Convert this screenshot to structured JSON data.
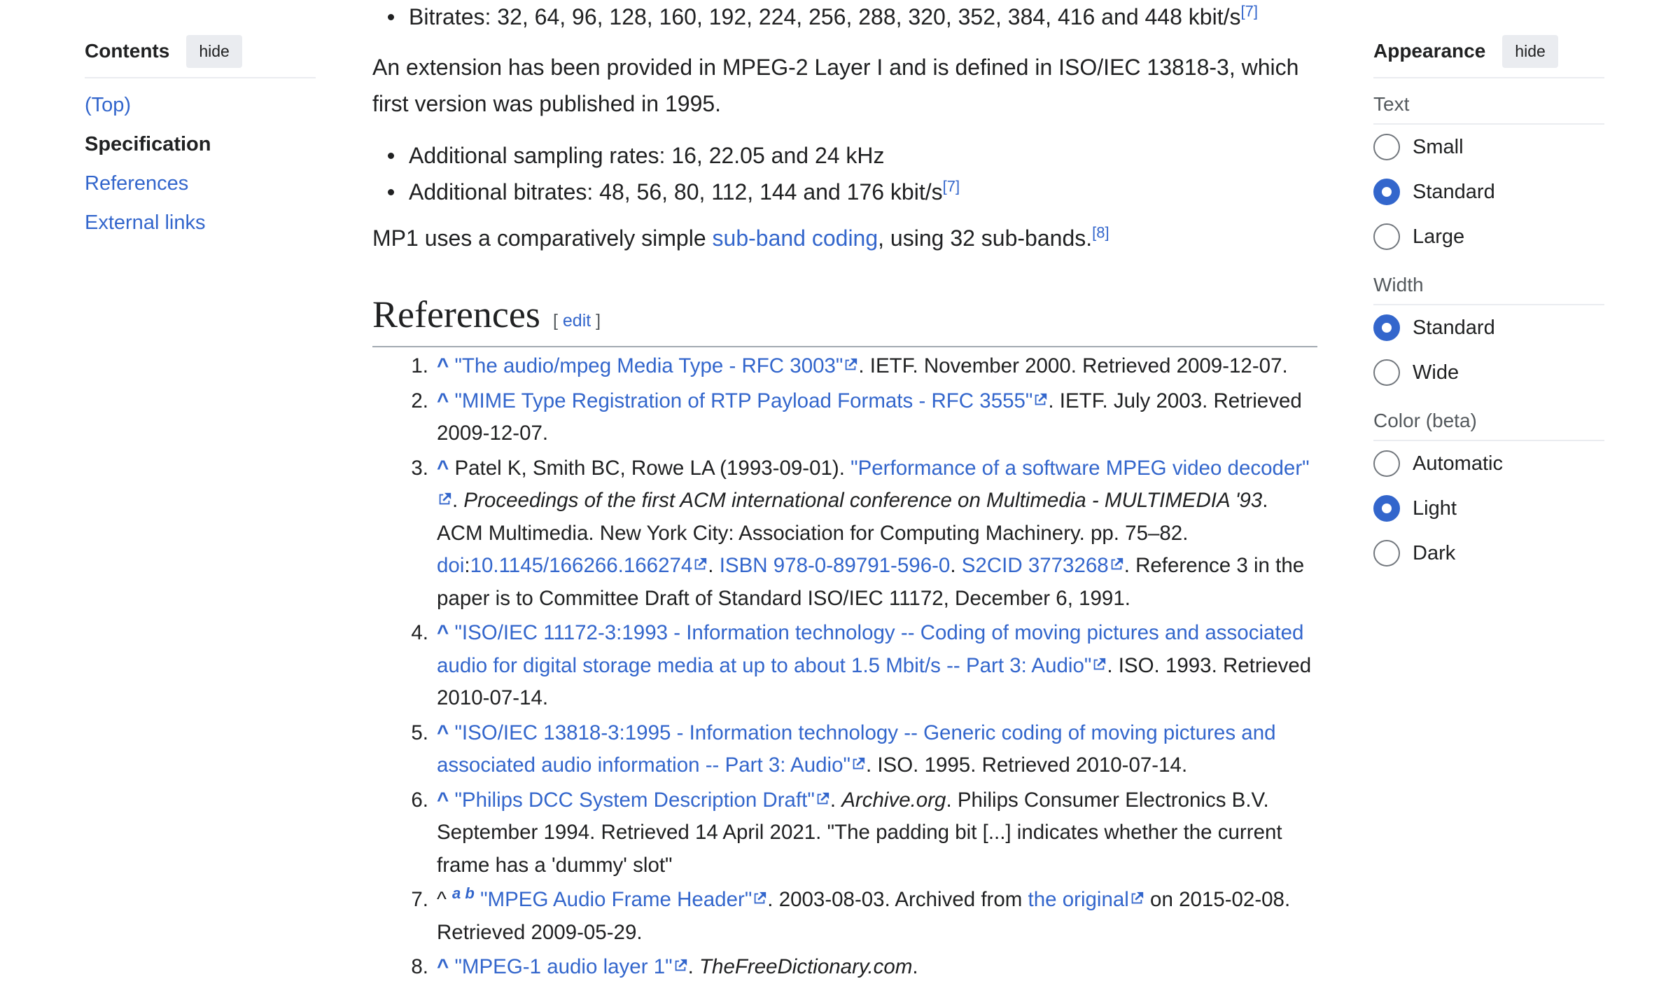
{
  "toc": {
    "title": "Contents",
    "hide_label": "hide",
    "items": [
      "(Top)",
      "Specification",
      "References",
      "External links"
    ]
  },
  "content": {
    "bitrates_prefix": "Bitrates: 32, 64, 96, 128, 160, 192, 224, 256, 288, 320, 352, 384, 416 and 448 kbit/s",
    "cite7": "[7]",
    "ext_para": "An extension has been provided in MPEG-2 Layer I and is defined in ISO/IEC 13818-3, which first version was published in 1995.",
    "add_sampling": "Additional sampling rates: 16, 22.05 and 24 kHz",
    "add_bitrates": "Additional bitrates: 48, 56, 80, 112, 144 and 176 kbit/s",
    "mp1_pre": "MP1 uses a comparatively simple ",
    "mp1_link": "sub-band coding",
    "mp1_post": ", using 32 sub-bands.",
    "cite8": "[8]"
  },
  "references_heading": {
    "title": "References",
    "edit_open": "[ ",
    "edit": "edit",
    "edit_close": " ]"
  },
  "references": [
    {
      "num": "1.",
      "link": "\"The audio/mpeg Media Type - RFC 3003\"",
      "rest": ". IETF. November 2000. Retrieved 2009-12-07."
    },
    {
      "num": "2.",
      "link": "\"MIME Type Registration of RTP Payload Formats - RFC 3555\"",
      "rest": ". IETF. July 2003. Retrieved 2009-12-07."
    },
    {
      "num": "3.",
      "pre": "Patel K, Smith BC, Rowe LA (1993-09-01). ",
      "link": "\"Performance of a software MPEG video decoder\"",
      "italic": "Proceedings of the first ACM international conference on Multimedia - MULTIMEDIA '93",
      "rest": ". ACM Multimedia. New York City: Association for Computing Machinery. pp. 75–82. ",
      "doi_label": "doi",
      "doi": "10.1145/166266.166274",
      "isbn": "ISBN 978-0-89791-596-0",
      "s2cid": "S2CID 3773268",
      "tail": ". Reference 3 in the paper is to Committee Draft of Standard ISO/IEC 11172, December 6, 1991."
    },
    {
      "num": "4.",
      "link": "\"ISO/IEC 11172-3:1993 - Information technology -- Coding of moving pictures and associated audio for digital storage media at up to about 1.5 Mbit/s -- Part 3: Audio\"",
      "rest": ". ISO. 1993. Retrieved 2010-07-14."
    },
    {
      "num": "5.",
      "link": "\"ISO/IEC 13818-3:1995 - Information technology -- Generic coding of moving pictures and associated audio information -- Part 3: Audio\"",
      "rest": ". ISO. 1995. Retrieved 2010-07-14."
    },
    {
      "num": "6.",
      "link": "\"Philips DCC System Description Draft\"",
      "italic": "Archive.org",
      "rest": ". Philips Consumer Electronics B.V. September 1994. Retrieved 14 April 2021. \"The padding bit [...] indicates whether the current frame has a 'dummy' slot\""
    },
    {
      "num": "7.",
      "backref_a": "a",
      "backref_b": "b",
      "link": "\"MPEG Audio Frame Header\"",
      "mid": ". 2003-08-03. Archived from ",
      "orig": "the original",
      "rest": " on 2015-02-08. Retrieved 2009-05-29."
    },
    {
      "num": "8.",
      "link": "\"MPEG-1 audio layer 1\"",
      "italic": "TheFreeDictionary.com",
      "rest": "."
    }
  ],
  "appearance": {
    "title": "Appearance",
    "hide_label": "hide",
    "text_label": "Text",
    "text_options": [
      "Small",
      "Standard",
      "Large"
    ],
    "text_selected": "Standard",
    "width_label": "Width",
    "width_options": [
      "Standard",
      "Wide"
    ],
    "width_selected": "Standard",
    "color_label": "Color (beta)",
    "color_options": [
      "Automatic",
      "Light",
      "Dark"
    ],
    "color_selected": "Light"
  },
  "colors": {
    "link": "#3366cc",
    "text": "#202122",
    "radio_on": "#3366cc"
  }
}
